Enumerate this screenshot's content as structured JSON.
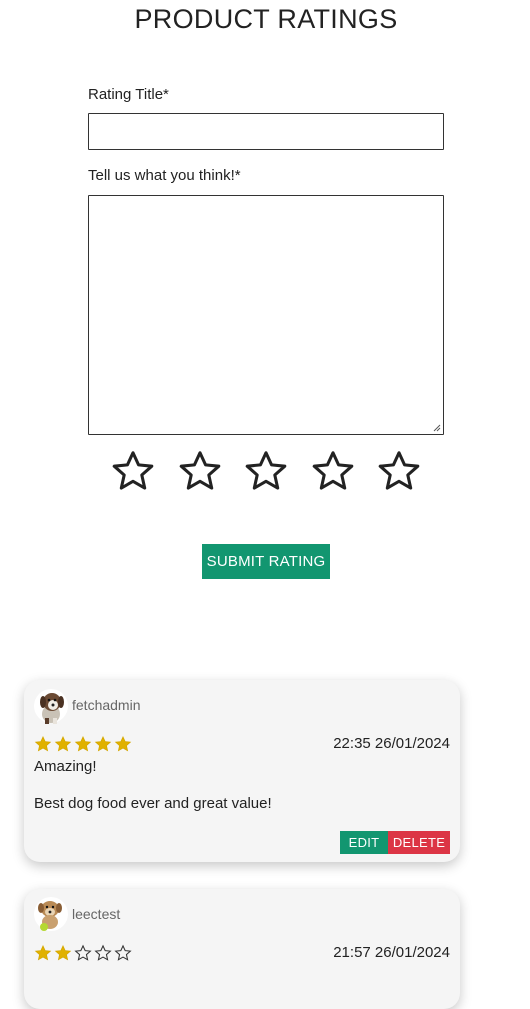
{
  "page": {
    "title": "PRODUCT RATINGS"
  },
  "form": {
    "title_label": "Rating Title*",
    "title_value": "",
    "comment_label": "Tell us what you think!*",
    "comment_value": "",
    "star_options": 5,
    "selected_rating": 0,
    "submit_label": "SUBMIT RATING"
  },
  "colors": {
    "accent": "#129670",
    "danger": "#dc3545",
    "star_filled": "#e0b100"
  },
  "reviews": [
    {
      "username": "fetchadmin",
      "avatar_icon": "puppy-avatar-icon",
      "rating": 5,
      "timestamp": "22:35 26/01/2024",
      "title": "Amazing!",
      "body": "Best dog food ever and great value!",
      "edit_label": "EDIT",
      "delete_label": "DELETE"
    },
    {
      "username": "leectest",
      "avatar_icon": "dog-avatar-icon",
      "rating": 2,
      "timestamp": "21:57 26/01/2024"
    }
  ]
}
